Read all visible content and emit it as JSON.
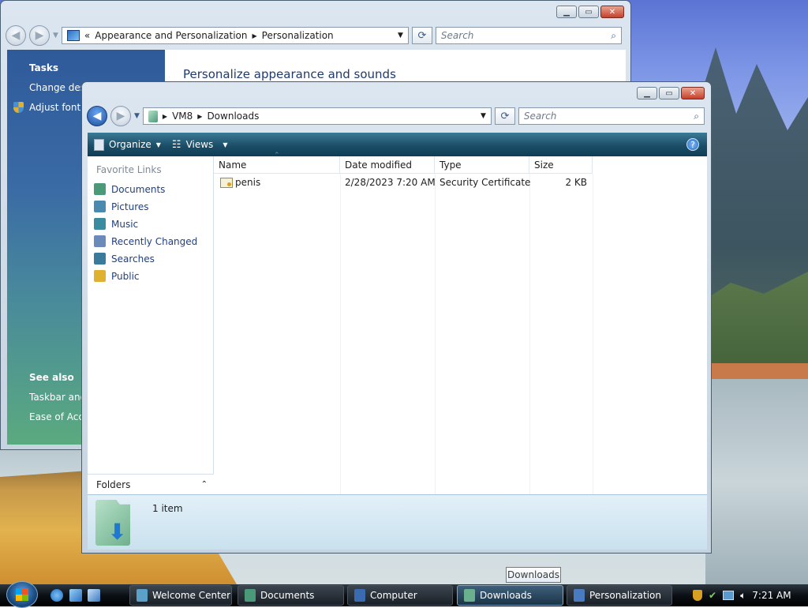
{
  "personalization_window": {
    "breadcrumb": [
      "«",
      "Appearance and Personalization",
      "Personalization"
    ],
    "search_placeholder": "Search",
    "tasks_header": "Tasks",
    "tasks": [
      "Change desk",
      "Adjust font s"
    ],
    "see_also_header": "See also",
    "see_also": [
      "Taskbar and",
      "Ease of Acce"
    ],
    "heading": "Personalize appearance and sounds"
  },
  "explorer": {
    "breadcrumb": [
      "VM8",
      "Downloads"
    ],
    "search_placeholder": "Search",
    "toolbar": {
      "organize": "Organize",
      "views": "Views",
      "help": "?"
    },
    "favorite_links_header": "Favorite Links",
    "favorite_links": [
      {
        "label": "Documents",
        "color": "#4a9a7a"
      },
      {
        "label": "Pictures",
        "color": "#4a8ab0"
      },
      {
        "label": "Music",
        "color": "#3a8aa0"
      },
      {
        "label": "Recently Changed",
        "color": "#6a8aba"
      },
      {
        "label": "Searches",
        "color": "#3a7a9a"
      },
      {
        "label": "Public",
        "color": "#e0b030"
      }
    ],
    "folders_label": "Folders",
    "columns": [
      "Name",
      "Date modified",
      "Type",
      "Size"
    ],
    "files": [
      {
        "name": "penis",
        "date": "2/28/2023 7:20 AM",
        "type": "Security Certificate",
        "size": "2 KB"
      }
    ],
    "status": "1 item"
  },
  "taskbar": {
    "tasks": [
      {
        "label": "Welcome Center",
        "icon": "#5aa0c8",
        "active": false
      },
      {
        "label": "Documents",
        "icon": "#4a9a7a",
        "active": false
      },
      {
        "label": "Computer",
        "icon": "#3a6ab0",
        "active": false
      },
      {
        "label": "Downloads",
        "icon": "#6ab08e",
        "active": true
      },
      {
        "label": "Personalization",
        "icon": "#4a7ac0",
        "active": false
      }
    ],
    "clock": "7:21 AM",
    "tooltip": "Downloads"
  }
}
